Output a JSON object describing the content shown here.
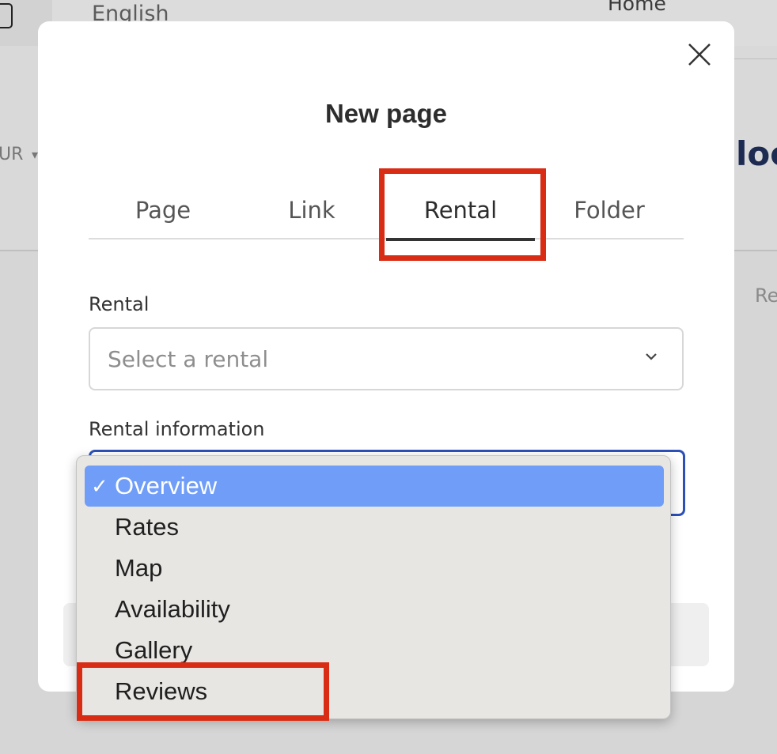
{
  "background": {
    "language": "English",
    "nav_home": "Home",
    "currency": "UR",
    "currency_caret": "▾",
    "logo_fragment": "loc",
    "right_fragment": "Re"
  },
  "modal": {
    "title": "New page",
    "close_icon": "close-icon",
    "tabs": [
      {
        "label": "Page",
        "active": false
      },
      {
        "label": "Link",
        "active": false
      },
      {
        "label": "Rental",
        "active": true
      },
      {
        "label": "Folder",
        "active": false
      }
    ],
    "rental_field": {
      "label": "Rental",
      "placeholder": "Select a rental"
    },
    "rental_info_field": {
      "label": "Rental information"
    }
  },
  "dropdown": {
    "check_mark": "✓",
    "options": [
      {
        "label": "Overview",
        "selected": true
      },
      {
        "label": "Rates",
        "selected": false
      },
      {
        "label": "Map",
        "selected": false
      },
      {
        "label": "Availability",
        "selected": false
      },
      {
        "label": "Gallery",
        "selected": false
      },
      {
        "label": "Reviews",
        "selected": false
      }
    ]
  },
  "colors": {
    "annotation": "#d92c14",
    "selected_option": "#6f9df7",
    "focus_border": "#2c50b8"
  }
}
